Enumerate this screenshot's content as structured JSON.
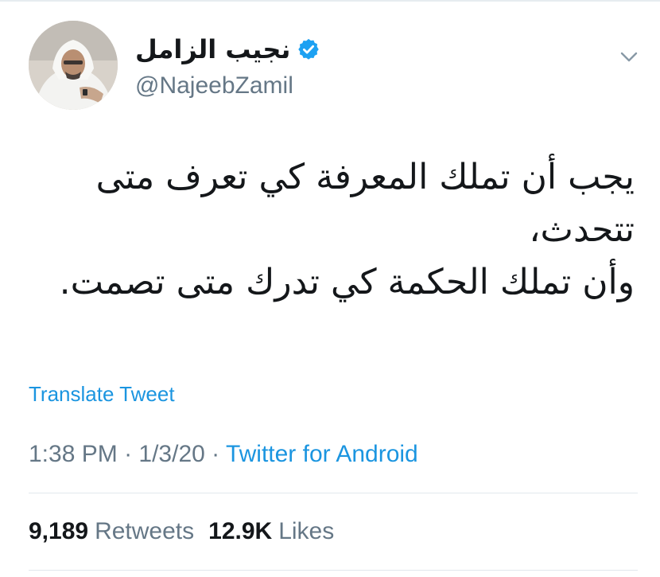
{
  "tweet": {
    "author": {
      "display_name": "نجيب الزامل",
      "handle": "@NajeebZamil",
      "verified": true,
      "avatar_icon": "profile-photo"
    },
    "text": "يجب أن تملك المعرفة كي تعرف متى\nتتحدث،\nوأن تملك الحكمة كي تدرك متى تصمت.",
    "translate_label": "Translate Tweet",
    "time": "1:38 PM",
    "separator": " · ",
    "date": "1/3/20",
    "source": "Twitter for Android",
    "stats": {
      "retweets_count": "9,189",
      "retweets_label": "Retweets",
      "likes_count": "12.9K",
      "likes_label": "Likes"
    },
    "caret_icon": "chevron-down-icon"
  },
  "colors": {
    "accent": "#1b95e0",
    "verified": "#1da1f2",
    "secondary_text": "#657786",
    "primary_text": "#14171a",
    "divider": "#e1e8ed"
  }
}
